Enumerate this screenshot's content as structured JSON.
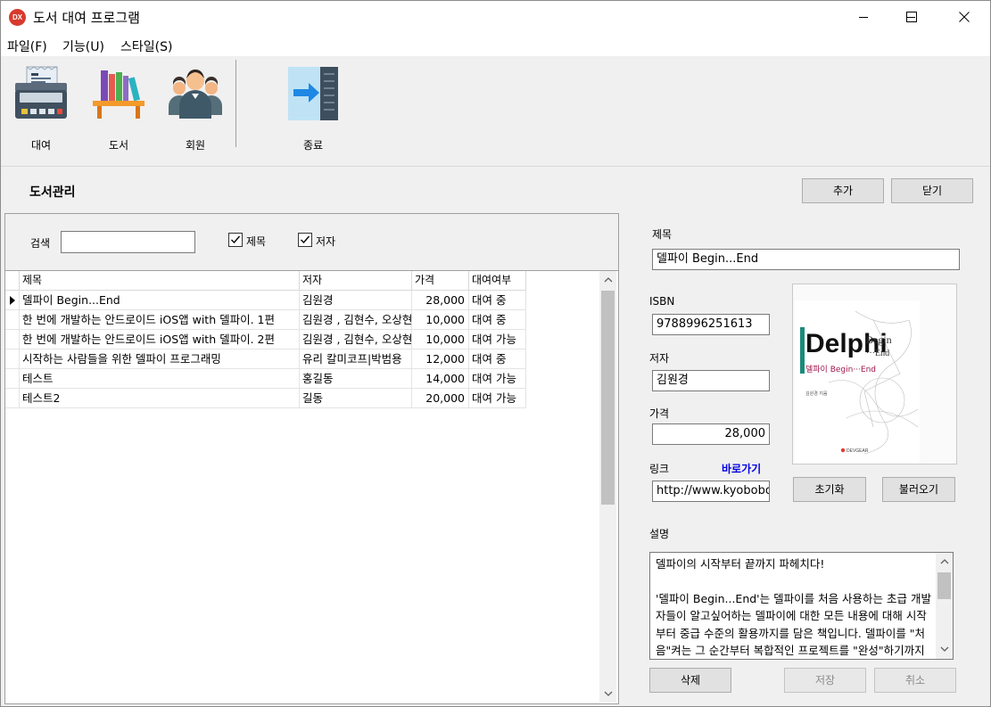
{
  "window": {
    "icon_text": "DX",
    "title": "도서 대여 프로그램"
  },
  "menu": [
    "파일(F)",
    "기능(U)",
    "스타일(S)"
  ],
  "toolbar": {
    "rent": "대여",
    "books": "도서",
    "members": "회원",
    "exit": "종료"
  },
  "header": {
    "title": "도서관리",
    "add_button": "추가",
    "close_button": "닫기"
  },
  "search": {
    "label": "검색",
    "value": "",
    "chk_title_label": "제목",
    "chk_title_checked": true,
    "chk_author_label": "저자",
    "chk_author_checked": true
  },
  "grid": {
    "columns": [
      "제목",
      "저자",
      "가격",
      "대여여부"
    ],
    "rows": [
      {
        "title": "델파이 Begin...End",
        "author": "김원경",
        "price": "28,000",
        "status": "대여 중",
        "current": true
      },
      {
        "title": "한 번에 개발하는 안드로이드 iOS앱 with 델파이. 1편",
        "author": "김원경 , 김현수, 오상현",
        "price": "10,000",
        "status": "대여 중",
        "current": false
      },
      {
        "title": "한 번에 개발하는 안드로이드 iOS앱 with 델파이. 2편",
        "author": "김원경 , 김현수, 오상현",
        "price": "10,000",
        "status": "대여 가능",
        "current": false
      },
      {
        "title": "시작하는 사람들을 위한 델파이 프로그래밍",
        "author": "유리 칼미코프|박범용",
        "price": "12,000",
        "status": "대여 중",
        "current": false
      },
      {
        "title": "테스트",
        "author": "홍길동",
        "price": "14,000",
        "status": "대여 가능",
        "current": false
      },
      {
        "title": "테스트2",
        "author": "길동",
        "price": "20,000",
        "status": "대여 가능",
        "current": false
      }
    ]
  },
  "detail": {
    "title_label": "제목",
    "title_value": "델파이 Begin...End",
    "isbn_label": "ISBN",
    "isbn_value": "9788996251613",
    "author_label": "저자",
    "author_value": "김원경",
    "price_label": "가격",
    "price_value": "28,000",
    "link_label": "링크",
    "link_action": "바로가기",
    "link_value": "http://www.kyobobook",
    "reset_button": "초기화",
    "load_button": "불러오기",
    "desc_label": "설명",
    "description": "델파이의 시작부터 끝까지 파헤치다!\n\n'델파이 Begin...End'는 델파이를 처음 사용하는 초급 개발자들이 알고싶어하는 델파이에 대한 모든 내용에 대해 시작부터 중급 수준의 활용까지를 담은 책입니다. 델파이를 \"처음\"켜는 그 순간부터 복합적인 프로젝트를 \"완성\"하기까지의 모든 내용을 이 한 권의 책을 통해 배울 수 있",
    "delete_button": "삭제",
    "save_button": "저장",
    "cancel_button": "취소"
  },
  "cover": {
    "brand": "Delphi",
    "subtitle_begin": "Begin",
    "subtitle_end": "···End",
    "korean_title": "델파이 Begin···End",
    "author_line": "김원경 지음",
    "publisher": "DEVGEAR"
  }
}
